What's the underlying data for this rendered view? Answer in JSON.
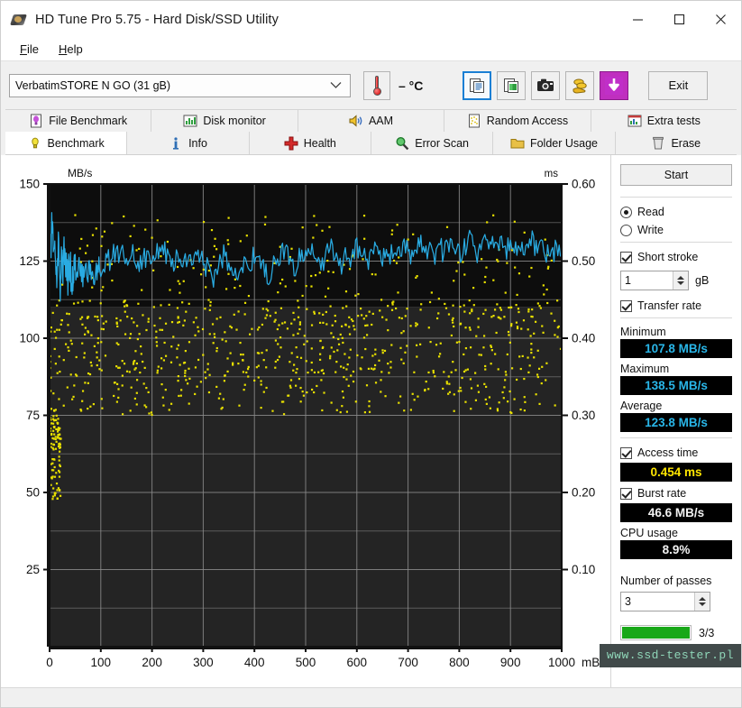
{
  "window": {
    "title": "HD Tune Pro 5.75 - Hard Disk/SSD Utility",
    "icon": "hard-disk-icon",
    "controls": {
      "minimize": "minimize-icon",
      "maximize": "maximize-icon",
      "close": "close-icon"
    }
  },
  "menu": {
    "items": [
      {
        "label": "File",
        "accel": "F"
      },
      {
        "label": "Help",
        "accel": "H"
      }
    ]
  },
  "toolbar": {
    "drive": {
      "value": "VerbatimSTORE N GO (31 gB)",
      "icon": "chevron-down-icon"
    },
    "temperature": {
      "icon": "thermometer-icon",
      "value": "– °C"
    },
    "buttons": [
      {
        "name": "copy-text-button",
        "icon": "copy-text-icon",
        "selected": true
      },
      {
        "name": "copy-image-button",
        "icon": "copy-image-icon",
        "selected": false
      },
      {
        "name": "screenshot-button",
        "icon": "camera-icon",
        "selected": false
      },
      {
        "name": "hand-coins-button",
        "icon": "hand-coins-icon",
        "selected": false
      },
      {
        "name": "download-button",
        "icon": "download-arrow-icon",
        "selected": false
      }
    ],
    "exit_label": "Exit"
  },
  "tabs": {
    "row1": [
      {
        "label": "File Benchmark",
        "icon": "bulb-document-icon",
        "active": false
      },
      {
        "label": "Disk monitor",
        "icon": "bar-chart-icon",
        "active": false
      },
      {
        "label": "AAM",
        "icon": "speaker-icon",
        "active": false
      },
      {
        "label": "Random Access",
        "icon": "scatter-icon",
        "active": false
      },
      {
        "label": "Extra tests",
        "icon": "chart-grid-icon",
        "active": false
      }
    ],
    "row2": [
      {
        "label": "Benchmark",
        "icon": "bulb-icon",
        "active": true
      },
      {
        "label": "Info",
        "icon": "info-icon",
        "active": false
      },
      {
        "label": "Health",
        "icon": "red-cross-icon",
        "active": false
      },
      {
        "label": "Error Scan",
        "icon": "magnifier-icon",
        "active": false
      },
      {
        "label": "Folder Usage",
        "icon": "folder-icon",
        "active": false
      },
      {
        "label": "Erase",
        "icon": "trash-icon",
        "active": false
      }
    ]
  },
  "panel": {
    "start_label": "Start",
    "mode": {
      "read_label": "Read",
      "write_label": "Write",
      "selected": "Read"
    },
    "short_stroke": {
      "label": "Short stroke",
      "checked": true,
      "value": "1",
      "unit": "gB"
    },
    "transfer_rate": {
      "label": "Transfer rate",
      "checked": true
    },
    "minimum": {
      "label": "Minimum",
      "value": "107.8 MB/s"
    },
    "maximum": {
      "label": "Maximum",
      "value": "138.5 MB/s"
    },
    "average": {
      "label": "Average",
      "value": "123.8 MB/s"
    },
    "access_time": {
      "label": "Access time",
      "checked": true,
      "value": "0.454 ms"
    },
    "burst_rate": {
      "label": "Burst rate",
      "checked": true,
      "value": "46.6 MB/s"
    },
    "cpu_usage": {
      "label": "CPU usage",
      "value": "8.9%"
    },
    "passes": {
      "label": "Number of passes",
      "value": "3",
      "progress_text": "3/3",
      "progress_percent": 100
    }
  },
  "watermark": "www.ssd-tester.pl",
  "colors": {
    "transfer_line": "#29abe2",
    "access_dots": "#e8e000",
    "chart_bg_top": "#0d0d0d",
    "chart_bg_bottom": "#242424",
    "grid": "#8c8c8c",
    "progress": "#18a818",
    "accent_select": "#1a7fd4"
  },
  "chart_data": {
    "type": "line",
    "title": "",
    "xlabel": "mB",
    "ylabel": "MB/s",
    "y2label": "ms",
    "xlim": [
      0,
      1000
    ],
    "ylim": [
      0,
      150
    ],
    "y2lim": [
      0,
      0.6
    ],
    "grid": true,
    "xticks": [
      0,
      100,
      200,
      300,
      400,
      500,
      600,
      700,
      800,
      900,
      1000
    ],
    "yticks": [
      25,
      50,
      75,
      100,
      125,
      150
    ],
    "y2ticks": [
      0.1,
      0.2,
      0.3,
      0.4,
      0.5,
      0.6
    ],
    "legend": "none",
    "series": [
      {
        "name": "Transfer rate",
        "type": "line",
        "color": "#29abe2",
        "axis": "left",
        "unit": "MB/s",
        "x": [
          2,
          5,
          8,
          11,
          14,
          17,
          20,
          23,
          26,
          29,
          32,
          35,
          38,
          41,
          44,
          47,
          50,
          55,
          60,
          65,
          70,
          75,
          80,
          85,
          90,
          95,
          100,
          110,
          120,
          130,
          140,
          150,
          160,
          170,
          180,
          190,
          200,
          210,
          220,
          230,
          240,
          250,
          260,
          270,
          280,
          290,
          300,
          310,
          320,
          330,
          340,
          350,
          360,
          370,
          380,
          390,
          400,
          410,
          420,
          430,
          440,
          450,
          460,
          470,
          480,
          490,
          500,
          510,
          520,
          530,
          540,
          550,
          560,
          570,
          580,
          590,
          600,
          610,
          620,
          630,
          640,
          650,
          660,
          670,
          680,
          690,
          700,
          710,
          720,
          730,
          740,
          750,
          760,
          770,
          780,
          790,
          800,
          810,
          820,
          830,
          840,
          850,
          860,
          870,
          880,
          890,
          900,
          910,
          920,
          930,
          940,
          950,
          960,
          970,
          980,
          990,
          1000
        ],
        "y": [
          130,
          137,
          128,
          133,
          120,
          132,
          114,
          126,
          122,
          128,
          123,
          119,
          124,
          122,
          118,
          123,
          121,
          124,
          122,
          120,
          123,
          121,
          122,
          119,
          121,
          123,
          122,
          124,
          126,
          129,
          127,
          125,
          128,
          126,
          124,
          127,
          125,
          128,
          130,
          126,
          124,
          127,
          125,
          123,
          126,
          128,
          125,
          122,
          119,
          124,
          127,
          125,
          123,
          121,
          126,
          124,
          127,
          125,
          122,
          120,
          124,
          127,
          129,
          125,
          123,
          127,
          125,
          128,
          126,
          124,
          127,
          129,
          126,
          124,
          128,
          126,
          129,
          127,
          125,
          128,
          130,
          127,
          125,
          129,
          127,
          130,
          128,
          126,
          129,
          131,
          128,
          126,
          130,
          128,
          131,
          129,
          127,
          130,
          132,
          129,
          127,
          131,
          129,
          132,
          130,
          128,
          131,
          129,
          127,
          130,
          132,
          129,
          131,
          128,
          126,
          130,
          128
        ]
      },
      {
        "name": "Access time",
        "type": "scatter",
        "color": "#e8e000",
        "axis": "right",
        "unit": "ms",
        "note": "Dense yellow scatter; most samples cluster between 0.34 and 0.46 ms across the span, with a low cluster near 0.19–0.28 ms at the start of the drive."
      }
    ]
  }
}
